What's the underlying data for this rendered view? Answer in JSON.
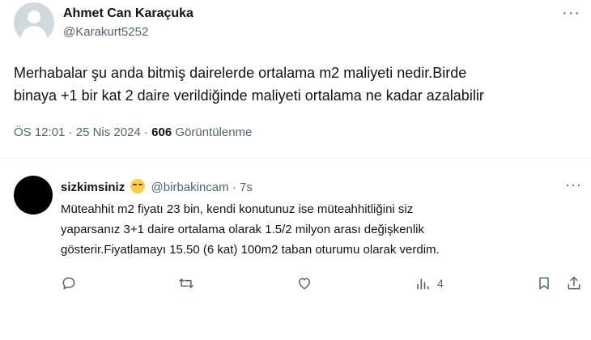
{
  "tweet": {
    "author_name": "Ahmet Can Karaçuka",
    "author_handle": "@Karakurt5252",
    "more_icon": "more-horizontal-icon",
    "text_lines": [
      "Merhabalar şu anda bitmiş dairelerde ortalama m2 maliyeti nedir.Birde",
      "binaya +1 bir kat 2 daire verildiğinde maliyeti ortalama ne kadar azalabilir"
    ],
    "time": "ÖS 12:01",
    "date": "25 Nis 2024",
    "separator": "·",
    "views_count": "606",
    "views_label": "Görüntülenme"
  },
  "reply": {
    "author_name": "sizkimsiniz",
    "emoji": "smirking-face",
    "author_handle": "@birbakincam",
    "separator": "·",
    "time_ago": "7s",
    "text_lines": [
      "Müteahhit m2 fiyatı 23 bin, kendi konutunuz ise müteahhitliğini siz",
      "yaparsanız 3+1 daire ortalama olarak 1.5/2 milyon arası değişkenlik",
      "gösterir.Fiyatlamayı 15.50 (6 kat) 100m2 taban oturumu olarak verdim."
    ],
    "actions": {
      "reply_icon": "comment-icon",
      "retweet_icon": "retweet-icon",
      "like_icon": "heart-icon",
      "views_icon": "analytics-icon",
      "views_count": "4",
      "bookmark_icon": "bookmark-icon",
      "share_icon": "share-icon"
    }
  },
  "colors": {
    "text_primary": "#0f1419",
    "text_secondary": "#536471",
    "divider": "#eff3f4"
  }
}
